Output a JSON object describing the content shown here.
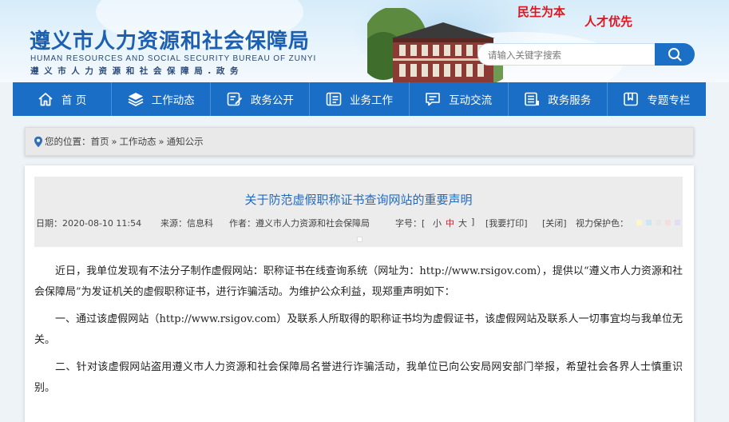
{
  "header": {
    "title": "遵义市人力资源和社会保障局",
    "title_en": "HUMAN RESOURCES AND SOCIAL SECURITY BUREAU OF ZUNYI",
    "subtitle": "遵义市人力资源和社会保障局.政务",
    "slogan_left": "民生为本",
    "slogan_right": "人才优先",
    "search_placeholder": "请输入关键字搜索"
  },
  "nav": [
    {
      "label": "首 页",
      "icon": "home-icon"
    },
    {
      "label": "工作动态",
      "icon": "layers-icon"
    },
    {
      "label": "政务公开",
      "icon": "document-edit-icon"
    },
    {
      "label": "业务工作",
      "icon": "id-card-icon"
    },
    {
      "label": "互动交流",
      "icon": "chat-icon"
    },
    {
      "label": "政务服务",
      "icon": "list-icon"
    },
    {
      "label": "专题专栏",
      "icon": "bookmark-icon"
    }
  ],
  "breadcrumb": {
    "prefix": "您的位置：",
    "items": [
      "首页",
      "工作动态",
      "通知公示"
    ],
    "separator": "»"
  },
  "article": {
    "title": "关于防范虚假职称证书查询网站的重要声明",
    "date": "日期：2020-08-10 11:54",
    "source": "来源：信息科",
    "author": "作者：遵义市人力资源和社会保障局",
    "fontsize_label": "字号：[",
    "fontsize_small": "小",
    "fontsize_medium": "中",
    "fontsize_large": "大",
    "fontsize_close": "]",
    "print": "[我要打印]",
    "close": "[关闭]",
    "eye_label": "视力保护色：",
    "eye_colors": [
      "#fbf7c9",
      "#cde6f7",
      "#e7e7e7",
      "#f4dcdf",
      "#e2dcf4",
      "#ffffff"
    ],
    "paragraphs": [
      "近日，我单位发现有不法分子制作虚假网站：职称证书在线查询系统（网址为：http://www.rsigov.com），提供以“遵义市人力资源和社会保障局”为发证机关的虚假职称证书，进行诈骗活动。为维护公众利益，现郑重声明如下：",
      "一、通过该虚假网站（http://www.rsigov.com）及联系人所取得的职称证书均为虚假证书，该虚假网站及联系人一切事宜均与我单位无关。",
      "二、针对该虚假网站盗用遵义市人力资源和社会保障局名誉进行诈骗活动，我单位已向公安局网安部门举报，希望社会各界人士慎重识别。"
    ]
  }
}
